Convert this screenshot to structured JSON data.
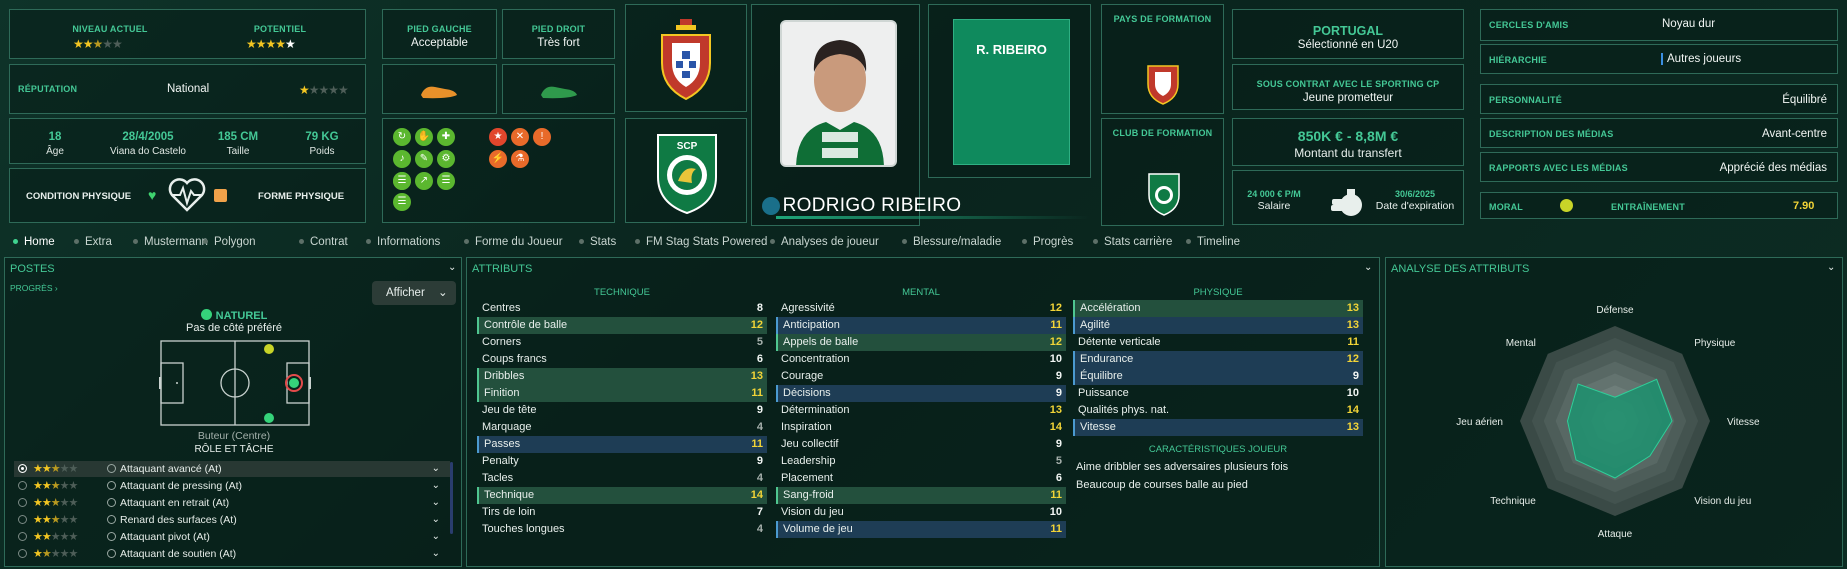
{
  "top": {
    "niveau_actuel": "NIVEAU ACTUEL",
    "potentiel": "POTENTIEL",
    "reputation_label": "RÉPUTATION",
    "reputation_value": "National",
    "age": "18",
    "age_label": "Âge",
    "birth": "28/4/2005",
    "birth_place": "Viana do Castelo",
    "height": "185 CM",
    "height_label": "Taille",
    "weight": "79 KG",
    "weight_label": "Poids",
    "condition_label": "CONDITION PHYSIQUE",
    "forme_label": "FORME PHYSIQUE",
    "pied_gauche_label": "PIED GAUCHE",
    "pied_gauche": "Acceptable",
    "pied_droit_label": "PIED DROIT",
    "pied_droit": "Très fort",
    "player_name": "RODRIGO RIBEIRO",
    "shirt_name": "R. RIBEIRO",
    "pays_formation": "PAYS DE FORMATION",
    "club_formation": "CLUB DE FORMATION",
    "nation": "PORTUGAL",
    "nation_sub": "Sélectionné en U20",
    "contrat_label": "SOUS CONTRAT AVEC LE SPORTING CP",
    "contrat_val": "Jeune prometteur",
    "transfer_value": "850K € - 8,8M €",
    "transfer_label": "Montant du transfert",
    "salary": "24 000 € P/M",
    "salary_label": "Salaire",
    "expiry": "30/6/2025",
    "expiry_label": "Date d'expiration"
  },
  "info": [
    {
      "label": "CERCLES D'AMIS",
      "value": "Noyau dur"
    },
    {
      "label": "HIÉRARCHIE",
      "value": "Autres joueurs"
    },
    {
      "label": "PERSONNALITÉ",
      "value": "Équilibré"
    },
    {
      "label": "DESCRIPTION DES MÉDIAS",
      "value": "Avant-centre"
    },
    {
      "label": "RAPPORTS AVEC LES MÉDIAS",
      "value": "Apprécié des médias"
    }
  ],
  "moral_label": "MORAL",
  "entrainement_label": "ENTRAÎNEMENT",
  "entrainement_value": "7.90",
  "tabs": [
    "Home",
    "Extra",
    "Mustermann",
    "Polygon",
    "Contrat",
    "Informations",
    "Forme du Joueur",
    "Stats",
    "FM Stag Stats Powered",
    "Analyses de joueur",
    "Blessure/maladie",
    "Progrès",
    "Stats carrière",
    "Timeline"
  ],
  "postes": {
    "title": "POSTES",
    "progres": "PROGRÈS",
    "afficher": "Afficher",
    "naturel": "NATUREL",
    "pied": "Pas de côté préféré",
    "role": "Buteur (Centre)",
    "role_tache": "RÔLE ET TÂCHE"
  },
  "roles": [
    {
      "name": "Attaquant avancé (At)",
      "stars": 2.5
    },
    {
      "name": "Attaquant de pressing (At)",
      "stars": 2.5
    },
    {
      "name": "Attaquant en retrait (At)",
      "stars": 2.5
    },
    {
      "name": "Renard des surfaces (At)",
      "stars": 2.5
    },
    {
      "name": "Attaquant pivot (At)",
      "stars": 2
    },
    {
      "name": "Attaquant de soutien (At)",
      "stars": 1.5
    }
  ],
  "attributs": {
    "title": "ATTRIBUTS",
    "technique": "TECHNIQUE",
    "mental": "MENTAL",
    "physique": "PHYSIQUE",
    "carac_title": "CARACTÉRISTIQUES JOUEUR",
    "tech": [
      [
        "Centres",
        "8",
        ""
      ],
      [
        "Contrôle de balle",
        "12",
        "g"
      ],
      [
        "Corners",
        "5",
        ""
      ],
      [
        "Coups francs",
        "6",
        ""
      ],
      [
        "Dribbles",
        "13",
        "g"
      ],
      [
        "Finition",
        "11",
        "g"
      ],
      [
        "Jeu de tête",
        "9",
        ""
      ],
      [
        "Marquage",
        "4",
        ""
      ],
      [
        "Passes",
        "11",
        "b"
      ],
      [
        "Penalty",
        "9",
        ""
      ],
      [
        "Tacles",
        "4",
        ""
      ],
      [
        "Technique",
        "14",
        "g"
      ],
      [
        "Tirs de loin",
        "7",
        ""
      ],
      [
        "Touches longues",
        "4",
        ""
      ]
    ],
    "ment": [
      [
        "Agressivité",
        "12",
        ""
      ],
      [
        "Anticipation",
        "11",
        "b"
      ],
      [
        "Appels de balle",
        "12",
        "g"
      ],
      [
        "Concentration",
        "10",
        ""
      ],
      [
        "Courage",
        "9",
        ""
      ],
      [
        "Décisions",
        "9",
        "b"
      ],
      [
        "Détermination",
        "13",
        ""
      ],
      [
        "Inspiration",
        "14",
        ""
      ],
      [
        "Jeu collectif",
        "9",
        ""
      ],
      [
        "Leadership",
        "5",
        ""
      ],
      [
        "Placement",
        "6",
        ""
      ],
      [
        "Sang-froid",
        "11",
        "g"
      ],
      [
        "Vision du jeu",
        "10",
        ""
      ],
      [
        "Volume de jeu",
        "11",
        "b"
      ]
    ],
    "phys": [
      [
        "Accélération",
        "13",
        "g"
      ],
      [
        "Agilité",
        "13",
        "b"
      ],
      [
        "Détente verticale",
        "11",
        ""
      ],
      [
        "Endurance",
        "12",
        "b"
      ],
      [
        "Équilibre",
        "9",
        "b"
      ],
      [
        "Puissance",
        "10",
        ""
      ],
      [
        "Qualités phys. nat.",
        "14",
        ""
      ],
      [
        "Vitesse",
        "13",
        "b"
      ]
    ],
    "carac": [
      "Aime dribbler ses adversaires plusieurs fois",
      "Beaucoup de courses balle au pied"
    ]
  },
  "analyse": {
    "title": "ANALYSE DES ATTRIBUTS",
    "axes": [
      "Défense",
      "Physique",
      "Vitesse",
      "Vision du jeu",
      "Attaque",
      "Technique",
      "Jeu aérien",
      "Mental"
    ],
    "values": [
      0.25,
      0.62,
      0.6,
      0.52,
      0.6,
      0.58,
      0.5,
      0.55
    ]
  }
}
